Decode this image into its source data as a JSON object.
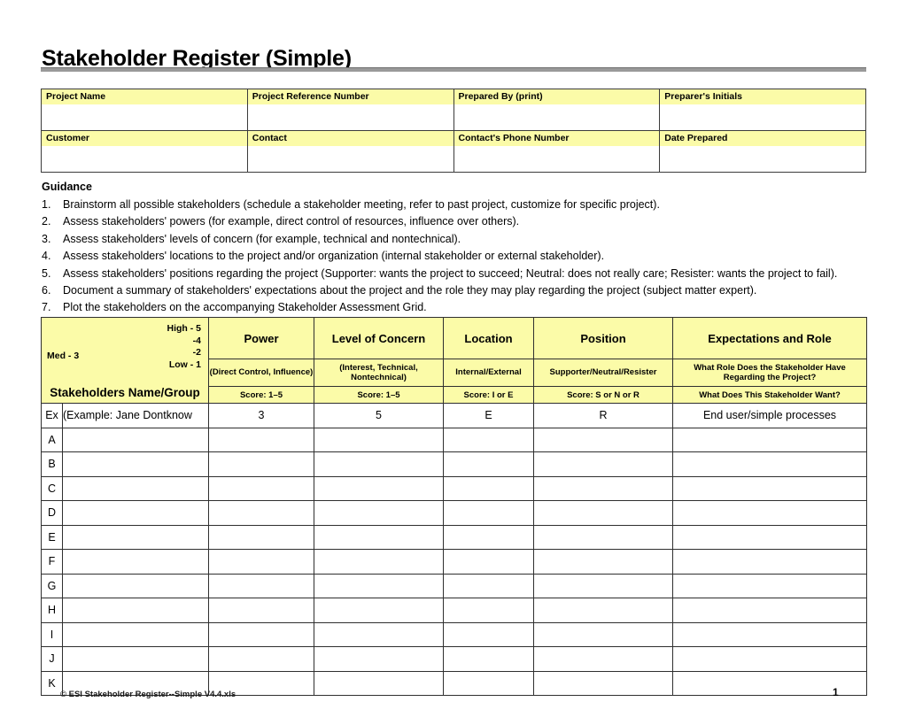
{
  "document": {
    "title": "Stakeholder Register (Simple)"
  },
  "info_fields": [
    [
      {
        "label": "Project Name",
        "value": ""
      },
      {
        "label": "Project Reference Number",
        "value": ""
      },
      {
        "label": "Prepared By (print)",
        "value": ""
      },
      {
        "label": "Preparer's Initials",
        "value": ""
      }
    ],
    [
      {
        "label": "Customer",
        "value": ""
      },
      {
        "label": "Contact",
        "value": ""
      },
      {
        "label": "Contact's Phone Number",
        "value": ""
      },
      {
        "label": "Date Prepared",
        "value": ""
      }
    ]
  ],
  "guidance": {
    "heading": "Guidance",
    "items": [
      {
        "num": "1.",
        "text": "Brainstorm all possible stakeholders (schedule a stakeholder meeting, refer to past project, customize for specific project)."
      },
      {
        "num": "2.",
        "text": "Assess stakeholders' powers (for example, direct control of resources, influence over others)."
      },
      {
        "num": "3.",
        "text": "Assess stakeholders' levels of concern (for example, technical and nontechnical)."
      },
      {
        "num": "4.",
        "text": "Assess stakeholders' locations to the project and/or organization (internal stakeholder or external stakeholder)."
      },
      {
        "num": "5.",
        "text": "Assess stakeholders' positions regarding the project (Supporter: wants the project to succeed; Neutral: does not really care; Resister: wants the project to fail)."
      },
      {
        "num": "6.",
        "text": "Document a summary of stakeholders' expectations about the project and the role they may play regarding the project (subject matter expert)."
      },
      {
        "num": "7.",
        "text": "Plot the stakeholders on the accompanying Stakeholder Assessment Grid."
      }
    ]
  },
  "register": {
    "legend": {
      "scale_lines": [
        "High - 5",
        "-4",
        "-2",
        "Low - 1"
      ],
      "med_label": "Med - 3",
      "name_column_header": "Stakeholders Name/Group"
    },
    "columns": [
      {
        "title": "Power",
        "subtitle": "(Direct Control, Influence)",
        "score": "Score: 1–5"
      },
      {
        "title": "Level of Concern",
        "subtitle": "(Interest, Technical, Nontechnical)",
        "score": "Score: 1–5"
      },
      {
        "title": "Location",
        "subtitle": "Internal/External",
        "score": "Score: I or E"
      },
      {
        "title": "Position",
        "subtitle": "Supporter/Neutral/Resister",
        "score": "Score: S or N or R"
      },
      {
        "title": "Expectations and Role",
        "subtitle": "What Role Does the Stakeholder Have Regarding the Project?",
        "score": "What Does This Stakeholder Want?"
      }
    ],
    "rows": [
      {
        "key": "Ex",
        "name": "(Example: Jane Dontknow",
        "power": "3",
        "concern": "5",
        "location": "E",
        "position": "R",
        "expectations": "End user/simple processes"
      },
      {
        "key": "A",
        "name": "",
        "power": "",
        "concern": "",
        "location": "",
        "position": "",
        "expectations": ""
      },
      {
        "key": "B",
        "name": "",
        "power": "",
        "concern": "",
        "location": "",
        "position": "",
        "expectations": ""
      },
      {
        "key": "C",
        "name": "",
        "power": "",
        "concern": "",
        "location": "",
        "position": "",
        "expectations": ""
      },
      {
        "key": "D",
        "name": "",
        "power": "",
        "concern": "",
        "location": "",
        "position": "",
        "expectations": ""
      },
      {
        "key": "E",
        "name": "",
        "power": "",
        "concern": "",
        "location": "",
        "position": "",
        "expectations": ""
      },
      {
        "key": "F",
        "name": "",
        "power": "",
        "concern": "",
        "location": "",
        "position": "",
        "expectations": ""
      },
      {
        "key": "G",
        "name": "",
        "power": "",
        "concern": "",
        "location": "",
        "position": "",
        "expectations": ""
      },
      {
        "key": "H",
        "name": "",
        "power": "",
        "concern": "",
        "location": "",
        "position": "",
        "expectations": ""
      },
      {
        "key": "I",
        "name": "",
        "power": "",
        "concern": "",
        "location": "",
        "position": "",
        "expectations": ""
      },
      {
        "key": "J",
        "name": "",
        "power": "",
        "concern": "",
        "location": "",
        "position": "",
        "expectations": ""
      },
      {
        "key": "K",
        "name": "",
        "power": "",
        "concern": "",
        "location": "",
        "position": "",
        "expectations": ""
      }
    ]
  },
  "footer": {
    "left": "© ESI    Stakeholder Register--Simple V4.4.xls",
    "page": "1"
  },
  "colors": {
    "header_yellow": "#fbfba8",
    "rule_gray": "#9a9a9a",
    "border": "#2f2f2f"
  }
}
